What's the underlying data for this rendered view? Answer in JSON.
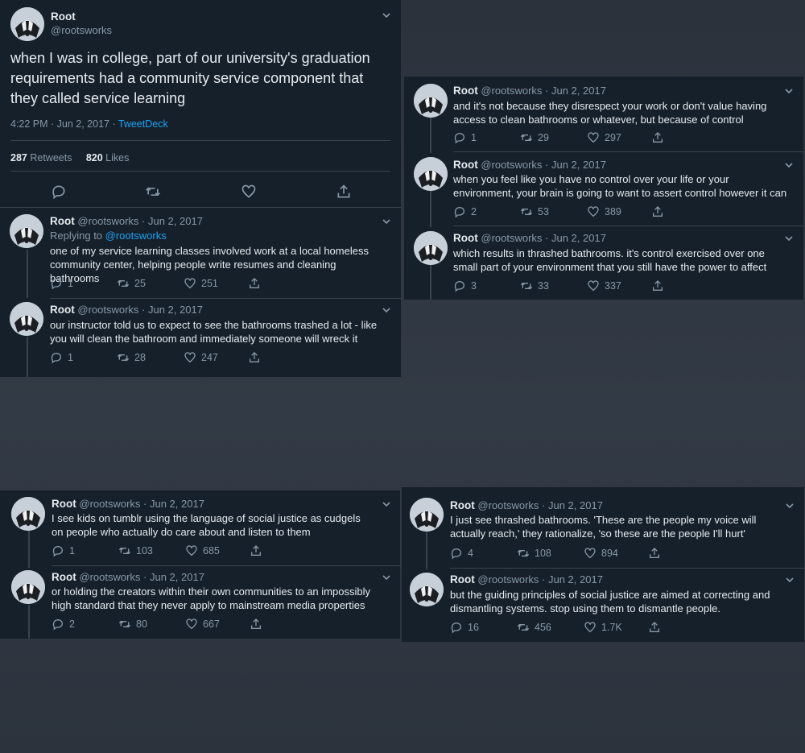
{
  "main_tweet": {
    "name": "Root",
    "handle": "@rootsworks",
    "text": "when I was in college, part of our university's graduation requirements had a community service component that they called service learning",
    "time": "4:22 PM · Jun 2, 2017 · ",
    "source": "TweetDeck",
    "retweets_count": "287",
    "retweets_label": "Retweets",
    "likes_count": "820",
    "likes_label": "Likes"
  },
  "panel1_replies": [
    {
      "name": "Root",
      "handle": "@rootsworks · Jun 2, 2017",
      "replying_label": "Replying to ",
      "replying_to": "@rootsworks",
      "text": "one of my service learning classes involved work at a local homeless community center, helping people write resumes and cleaning bathrooms",
      "replies": "1",
      "retweets": "25",
      "likes": "251"
    },
    {
      "name": "Root",
      "handle": "@rootsworks · Jun 2, 2017",
      "text": "our instructor told us to expect to see the bathrooms trashed a lot - like you will clean the bathroom and immediately someone will wreck it",
      "replies": "1",
      "retweets": "28",
      "likes": "247"
    }
  ],
  "panel2": [
    {
      "name": "Root",
      "handle": "@rootsworks · Jun 2, 2017",
      "text": "and it's not because they disrespect your work or don't value having access to clean bathrooms or whatever, but because of control",
      "replies": "1",
      "retweets": "29",
      "likes": "297"
    },
    {
      "name": "Root",
      "handle": "@rootsworks · Jun 2, 2017",
      "text": "when you feel like you have no control over your life or your environment, your brain is going to want to assert control however it can",
      "replies": "2",
      "retweets": "53",
      "likes": "389"
    },
    {
      "name": "Root",
      "handle": "@rootsworks · Jun 2, 2017",
      "text": "which results in thrashed bathrooms. it's control exercised over one small part of your environment that you still have the power to affect",
      "replies": "3",
      "retweets": "33",
      "likes": "337"
    }
  ],
  "panel3": [
    {
      "name": "Root",
      "handle": "@rootsworks · Jun 2, 2017",
      "text": "I see kids on tumblr using the language of social justice as cudgels on people who actually do care about and listen to them",
      "replies": "1",
      "retweets": "103",
      "likes": "685"
    },
    {
      "name": "Root",
      "handle": "@rootsworks · Jun 2, 2017",
      "text": "or holding the creators within their own communities to an impossibly high standard that they never apply to mainstream media properties",
      "replies": "2",
      "retweets": "80",
      "likes": "667"
    }
  ],
  "panel4": [
    {
      "name": "Root",
      "handle": "@rootsworks · Jun 2, 2017",
      "text": "I just see thrashed bathrooms. 'These are the people my voice will actually reach,' they rationalize, 'so these are the people I'll hurt'",
      "replies": "4",
      "retweets": "108",
      "likes": "894"
    },
    {
      "name": "Root",
      "handle": "@rootsworks · Jun 2, 2017",
      "text": "but the guiding principles of social justice are aimed at correcting and dismantling systems. stop using them to dismantle people.",
      "replies": "16",
      "retweets": "456",
      "likes": "1.7K"
    }
  ],
  "icons": {
    "chevron": "chevron-down-icon",
    "reply": "reply-icon",
    "retweet": "retweet-icon",
    "like": "heart-icon",
    "share": "share-icon",
    "avatar": "badger-avatar"
  },
  "colors": {
    "background": "#15202b",
    "link": "#1da1f2",
    "muted": "#8899a6",
    "text": "#e6ebef"
  }
}
